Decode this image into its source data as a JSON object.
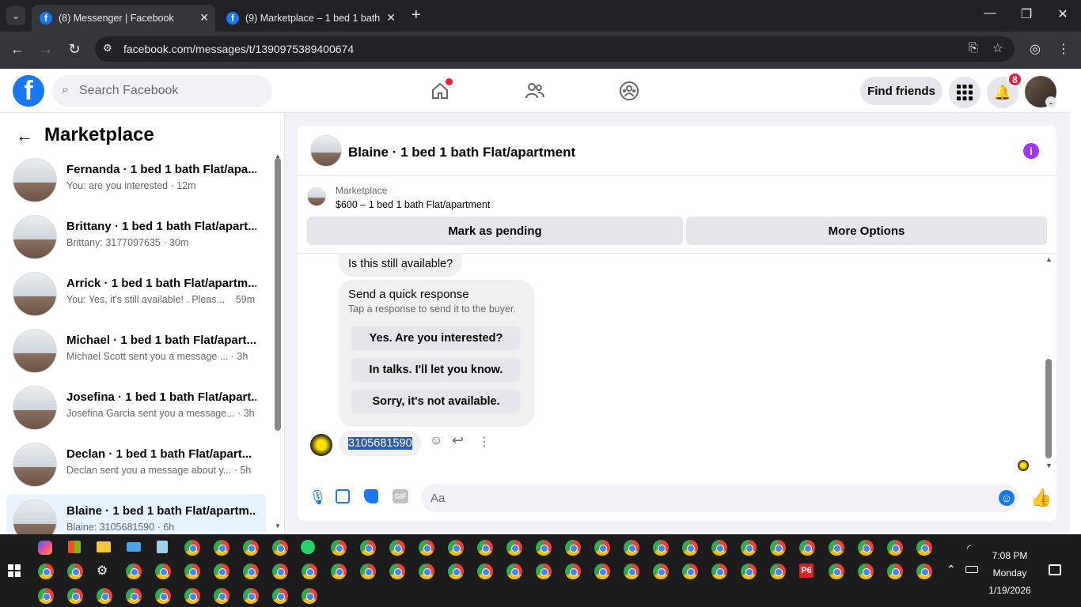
{
  "browser": {
    "tabs": [
      {
        "title": "(8) Messenger | Facebook",
        "active": true
      },
      {
        "title": "(9) Marketplace – 1 bed 1 bath",
        "active": false
      }
    ],
    "url": "facebook.com/messages/t/1390975389400674"
  },
  "header": {
    "search_placeholder": "Search Facebook",
    "find_friends": "Find friends",
    "notification_count": "8"
  },
  "sidebar": {
    "title": "Marketplace",
    "conversations": [
      {
        "name": "Fernanda · 1 bed 1 bath Flat/apa...",
        "preview": "You: are you interested · 12m"
      },
      {
        "name": "Brittany · 1 bed 1 bath Flat/apart...",
        "preview": "Brittany: 3177097635 · 30m"
      },
      {
        "name": "Arrick · 1 bed 1 bath Flat/apartm...",
        "preview": "You: Yes, it's still available! . Pleas...    59m"
      },
      {
        "name": "Michael · 1 bed 1 bath Flat/apart...",
        "preview": "Michael Scott sent you a message ...  · 3h"
      },
      {
        "name": "Josefina · 1 bed 1 bath Flat/apart...",
        "preview": "Josefina Garcia sent you a message... · 3h"
      },
      {
        "name": "Declan · 1 bed 1 bath Flat/apart...",
        "preview": "Declan sent you a message about y... · 5h"
      },
      {
        "name": "Blaine · 1 bed 1 bath Flat/apartm...",
        "preview": "Blaine: 3105681590 · 6h"
      }
    ]
  },
  "chat": {
    "title": "Blaine · 1 bed 1 bath Flat/apartment",
    "marketplace_label": "Marketplace",
    "listing": "$600 – 1 bed 1 bath Flat/apartment",
    "mark_pending": "Mark as pending",
    "more_options": "More Options",
    "message_question": "Is this still available?",
    "quick_title": "Send a quick response",
    "quick_subtitle": "Tap a response to send it to the buyer.",
    "quick_responses": [
      "Yes. Are you interested?",
      "In talks. I'll let you know.",
      "Sorry, it's not available."
    ],
    "phone_message": "3105681590",
    "input_placeholder": "Aa"
  },
  "taskbar": {
    "time": "7:08 PM",
    "day": "Monday",
    "date": "1/19/2026",
    "p6_label": "P6"
  },
  "colors": {
    "fb_blue": "#1877f2",
    "selected_bg": "#e7f3ff",
    "info_purple": "#a033ff"
  }
}
